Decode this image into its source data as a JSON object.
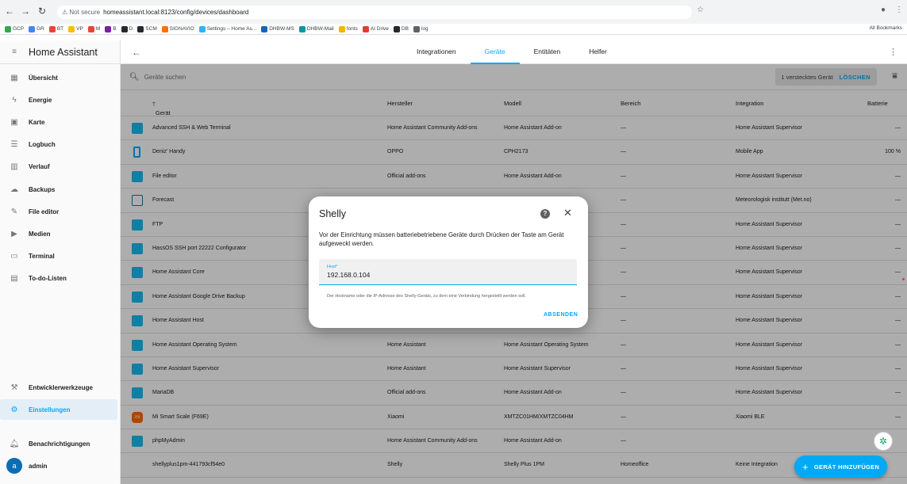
{
  "browser": {
    "warning": "Not secure",
    "url": "homeassistant.local:8123/config/devices/dashboard",
    "bookmarks": [
      "GCP",
      "GR",
      "BT",
      "VP",
      "M",
      "B",
      "D",
      "SCM",
      "SIGNAVIO",
      "Settings – Home As...",
      "DHBW-MS",
      "DHBW-Mail",
      "fonts",
      "AI Drive",
      "DB",
      "log"
    ],
    "all_bookmarks": "All Bookmarks"
  },
  "sidebar": {
    "title": "Home Assistant",
    "items": [
      {
        "label": "Übersicht",
        "icon": "dashboard-icon",
        "glyph": "▦"
      },
      {
        "label": "Energie",
        "icon": "lightning-icon",
        "glyph": "ϟ"
      },
      {
        "label": "Karte",
        "icon": "map-icon",
        "glyph": "▣"
      },
      {
        "label": "Logbuch",
        "icon": "list-icon",
        "glyph": "☰"
      },
      {
        "label": "Verlauf",
        "icon": "chart-icon",
        "glyph": "▥"
      },
      {
        "label": "Backups",
        "icon": "cloud-icon",
        "glyph": "☁"
      },
      {
        "label": "File editor",
        "icon": "wrench-icon",
        "glyph": "✎"
      },
      {
        "label": "Medien",
        "icon": "media-icon",
        "glyph": "▶"
      },
      {
        "label": "Terminal",
        "icon": "terminal-icon",
        "glyph": "▭"
      },
      {
        "label": "To-do-Listen",
        "icon": "clipboard-icon",
        "glyph": "▤"
      }
    ],
    "dev_tools": "Entwicklerwerkzeuge",
    "settings": "Einstellungen",
    "notifications": "Benachrichtigungen",
    "user": "admin",
    "user_initial": "a"
  },
  "tabs": [
    "Integrationen",
    "Geräte",
    "Entitäten",
    "Helfer"
  ],
  "active_tab": "Geräte",
  "search": {
    "placeholder": "Geräte suchen"
  },
  "hidden": {
    "label": "1 verstecktes Gerät",
    "action": "LÖSCHEN"
  },
  "columns": {
    "device": "Gerät",
    "manufacturer": "Hersteller",
    "model": "Modell",
    "area": "Bereich",
    "integration": "Integration",
    "battery": "Batterie"
  },
  "rows": [
    {
      "name": "Advanced SSH & Web Terminal",
      "manufacturer": "Home Assistant Community Add-ons",
      "model": "Home Assistant Add-on",
      "area": "—",
      "integration": "Home Assistant Supervisor",
      "battery": "—",
      "icon": "ha"
    },
    {
      "name": "Deniz' Handy",
      "manufacturer": "OPPO",
      "model": "CPH2173",
      "area": "—",
      "integration": "Mobile App",
      "battery": "100 %",
      "icon": "phone"
    },
    {
      "name": "File editor",
      "manufacturer": "Official add-ons",
      "model": "Home Assistant Add-on",
      "area": "—",
      "integration": "Home Assistant Supervisor",
      "battery": "—",
      "icon": "ha"
    },
    {
      "name": "Forecast",
      "manufacturer": "",
      "model": "",
      "area": "—",
      "integration": "Meteorologisk institutt (Met.no)",
      "battery": "—",
      "icon": "fc"
    },
    {
      "name": "FTP",
      "manufacturer": "",
      "model": "",
      "area": "—",
      "integration": "Home Assistant Supervisor",
      "battery": "—",
      "icon": "ha"
    },
    {
      "name": "HassOS SSH port 22222 Configurator",
      "manufacturer": "",
      "model": "",
      "area": "—",
      "integration": "Home Assistant Supervisor",
      "battery": "—",
      "icon": "ha"
    },
    {
      "name": "Home Assistant Core",
      "manufacturer": "",
      "model": "",
      "area": "—",
      "integration": "Home Assistant Supervisor",
      "battery": "—",
      "icon": "ha"
    },
    {
      "name": "Home Assistant Google Drive Backup",
      "manufacturer": "",
      "model": "",
      "area": "—",
      "integration": "Home Assistant Supervisor",
      "battery": "—",
      "icon": "ha"
    },
    {
      "name": "Home Assistant Host",
      "manufacturer": "",
      "model": "",
      "area": "—",
      "integration": "Home Assistant Supervisor",
      "battery": "—",
      "icon": "ha"
    },
    {
      "name": "Home Assistant Operating System",
      "manufacturer": "Home Assistant",
      "model": "Home Assistant Operating System",
      "area": "—",
      "integration": "Home Assistant Supervisor",
      "battery": "—",
      "icon": "ha"
    },
    {
      "name": "Home Assistant Supervisor",
      "manufacturer": "Home Assistant",
      "model": "Home Assistant Supervisor",
      "area": "—",
      "integration": "Home Assistant Supervisor",
      "battery": "—",
      "icon": "ha"
    },
    {
      "name": "MariaDB",
      "manufacturer": "Official add-ons",
      "model": "Home Assistant Add-on",
      "area": "—",
      "integration": "Home Assistant Supervisor",
      "battery": "—",
      "icon": "ha"
    },
    {
      "name": "Mi Smart Scale (F69E)",
      "manufacturer": "Xiaomi",
      "model": "XMTZC01HM/XMTZC04HM",
      "area": "—",
      "integration": "Xiaomi BLE",
      "battery": "—",
      "icon": "mi"
    },
    {
      "name": "phpMyAdmin",
      "manufacturer": "Home Assistant Community Add-ons",
      "model": "Home Assistant Add-on",
      "area": "—",
      "integration": "",
      "battery": "",
      "icon": "ha"
    },
    {
      "name": "shellyplus1pm-441793cf54e0",
      "manufacturer": "Shelly",
      "model": "Shelly Plus 1PM",
      "area": "Homeoffice",
      "integration": "Keine Integration",
      "battery": "",
      "icon": "none"
    }
  ],
  "dialog": {
    "title": "Shelly",
    "description": "Vor der Einrichtung müssen batteriebetriebene Geräte durch Drücken der Taste am Gerät aufgeweckt werden.",
    "field_label": "Host*",
    "field_value": "192.168.0.104",
    "hint": "Der Hostname oder die IP-Adresse des Shelly-Geräts, zu dem eine Verbindung hergestellt werden soll.",
    "submit": "ABSENDEN"
  },
  "fab": {
    "label": "GERÄT HINZUFÜGEN"
  },
  "colors": {
    "accent": "#03a9f4",
    "sidebar_bg": "#fafafa",
    "overlay": "rgba(0,0,0,0.32)"
  }
}
